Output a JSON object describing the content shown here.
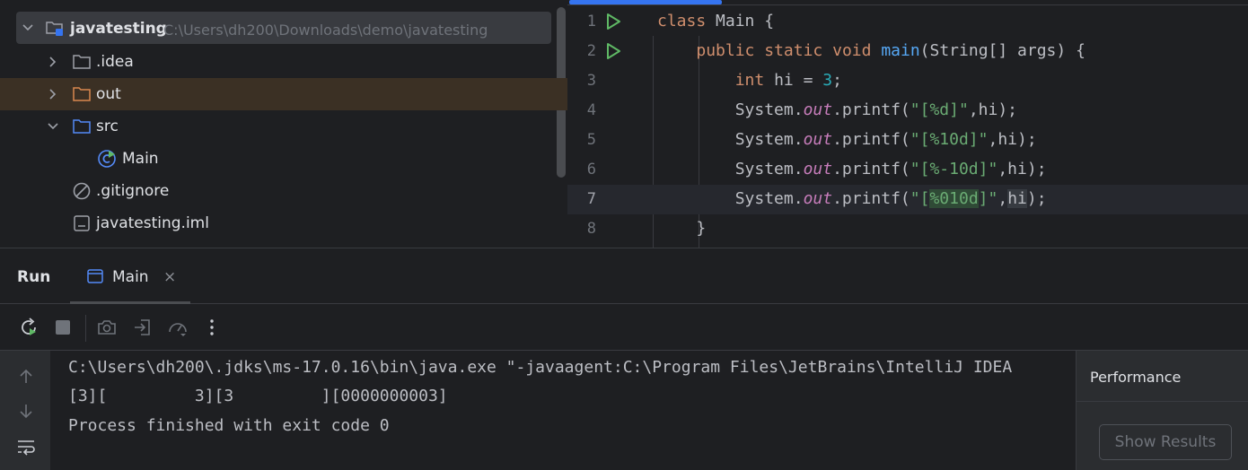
{
  "project_tree": {
    "root": {
      "name": "javatesting",
      "path": "C:\\Users\\dh200\\Downloads\\demo\\javatesting"
    },
    "items": [
      {
        "label": ".idea",
        "icon": "folder-icon"
      },
      {
        "label": "out",
        "icon": "folder-excluded-icon"
      },
      {
        "label": "src",
        "icon": "source-folder-icon"
      },
      {
        "label": "Main",
        "icon": "java-class-runnable-icon"
      },
      {
        "label": ".gitignore",
        "icon": "ignored-file-icon"
      },
      {
        "label": "javatesting.iml",
        "icon": "module-file-icon"
      }
    ]
  },
  "editor": {
    "line_numbers": [
      "1",
      "2",
      "3",
      "4",
      "5",
      "6",
      "7",
      "8"
    ],
    "current_line": 7,
    "tokens": {
      "class_kw": "class",
      "class_name": "Main",
      "brace_open": "{",
      "public_kw": "public",
      "static_kw": "static",
      "void_kw": "void",
      "main_fn": "main",
      "main_params": "(String[] args) {",
      "int_kw": "int",
      "hi_assign": "hi =",
      "three": "3",
      "semicolon": ";",
      "system": "System.",
      "out": "out",
      "printf_open": ".printf(",
      "str1": "\"[%d]\"",
      "str2": "\"[%10d]\"",
      "str3": "\"[%-10d]\"",
      "str4_q1": "\"[",
      "str4_fmt": "%010d",
      "str4_q2": "]\"",
      "comma": ",",
      "hi": "hi",
      "args_close": ");",
      "brace_close": "}"
    }
  },
  "run": {
    "title": "Run",
    "tab_label": "Main",
    "tab_close": "×",
    "console_lines": [
      "C:\\Users\\dh200\\.jdks\\ms-17.0.16\\bin\\java.exe \"-javaagent:C:\\Program Files\\JetBrains\\IntelliJ IDEA",
      "[3][         3][3         ][0000000003]",
      "Process finished with exit code 0"
    ],
    "performance": {
      "title": "Performance",
      "button": "Show Results"
    }
  },
  "colors": {
    "background": "#1e1f22",
    "panel": "#2b2d30",
    "accent": "#3574f0",
    "keyword": "#cf8e6d",
    "function": "#56a8f5",
    "number": "#2aacb8",
    "string": "#6aab73",
    "field": "#c77dbb",
    "run_green": "#5fb865",
    "excluded_folder": "#d9884f"
  }
}
